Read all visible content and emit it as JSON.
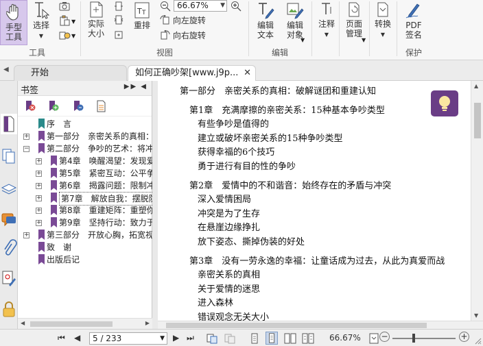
{
  "ribbon": {
    "hand_tool": "手型\n工具",
    "select": "选择",
    "actual_size": "实际\n大小",
    "reflow": "重排",
    "zoom_value": "66.67%",
    "rotate_left": "向左旋转",
    "rotate_right": "向右旋转",
    "edit_text": "编辑\n文本",
    "edit_object": "编辑\n对象",
    "annotate": "注释",
    "page_manage": "页面\n管理",
    "convert": "转换",
    "pdf_sign": "PDF\n签名",
    "groups": {
      "tools": "工具",
      "view": "视图",
      "edit": "编辑",
      "protect": "保护"
    }
  },
  "tabs": {
    "home": "开始",
    "doc": "如何正确吵架[www.j9p..."
  },
  "bookmarks": {
    "title": "书签",
    "items": [
      {
        "label": "序　言",
        "indent": 0,
        "expander": "",
        "selected": false
      },
      {
        "label": "第一部分　亲密关系的真相：",
        "indent": 0,
        "expander": "+",
        "selected": false
      },
      {
        "label": "第二部分　争吵的艺术：将冲",
        "indent": 0,
        "expander": "−",
        "selected": false
      },
      {
        "label": "第4章　唤醒渴望：发现爱",
        "indent": 1,
        "expander": "+",
        "selected": false
      },
      {
        "label": "第5章　紧密互动：公平争",
        "indent": 1,
        "expander": "+",
        "selected": false
      },
      {
        "label": "第6章　揭露问题：限制冲",
        "indent": 1,
        "expander": "+",
        "selected": false
      },
      {
        "label": "第7章　解放自我：摆脱防",
        "indent": 1,
        "expander": "+",
        "selected": true
      },
      {
        "label": "第8章　重建矩阵：重塑你",
        "indent": 1,
        "expander": "+",
        "selected": false
      },
      {
        "label": "第9章　坚持行动：致力于",
        "indent": 1,
        "expander": "+",
        "selected": false
      },
      {
        "label": "第三部分　开放心胸，拓宽视",
        "indent": 0,
        "expander": "+",
        "selected": false
      },
      {
        "label": "致　谢",
        "indent": 0,
        "expander": "",
        "selected": false
      },
      {
        "label": "出版后记",
        "indent": 0,
        "expander": "",
        "selected": false
      }
    ]
  },
  "document": {
    "lines": [
      {
        "text": "第一部分　亲密关系的真相：破解谜团和重建认知",
        "level": 0
      },
      {
        "text": "第1章　充满摩擦的亲密关系：15种基本争吵类型",
        "level": 1
      },
      {
        "text": "有些争吵是值得的",
        "level": 2
      },
      {
        "text": "建立或破坏亲密关系的15种争吵类型",
        "level": 2
      },
      {
        "text": "获得幸福的6个技巧",
        "level": 2
      },
      {
        "text": "勇于进行有目的性的争吵",
        "level": 2
      },
      {
        "text": "第2章　爱情中的不和谐音：始终存在的矛盾与冲突",
        "level": 1
      },
      {
        "text": "深入爱情困局",
        "level": 2
      },
      {
        "text": "冲突是为了生存",
        "level": 2
      },
      {
        "text": "在悬崖边缘挣扎",
        "level": 2
      },
      {
        "text": "放下姿态、撕掉伪装的好处",
        "level": 2
      },
      {
        "text": "第3章　没有一劳永逸的幸福：让童话成为过去，从此为真爱而战",
        "level": 1
      },
      {
        "text": "亲密关系的真相",
        "level": 2
      },
      {
        "text": "关于爱情的迷思",
        "level": 2
      },
      {
        "text": "进入森林",
        "level": 2
      },
      {
        "text": "错误观念无关大小",
        "level": 2
      }
    ]
  },
  "status": {
    "page": "5 / 233",
    "zoom": "66.67%",
    "minus": "−",
    "plus": "+"
  },
  "colors": {
    "accent_purple": "#6a3d86",
    "bookmark_purple": "#7a4a96",
    "bookmark_teal": "#2a8a8a"
  }
}
